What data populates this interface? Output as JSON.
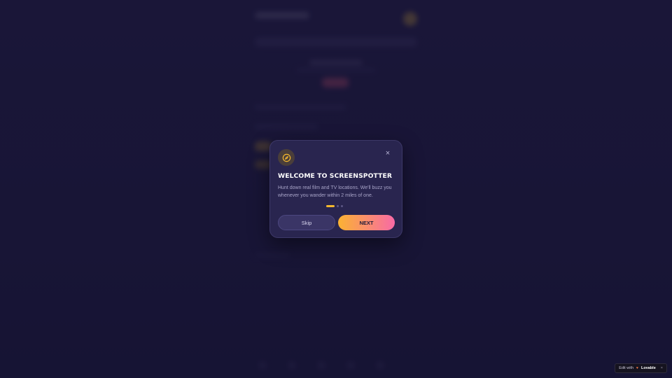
{
  "modal": {
    "title": "Welcome to ScreenSpotter",
    "body": "Hunt down real film and TV locations. We'll buzz you whenever you wander within 2 miles of one.",
    "close_symbol": "×",
    "icon": "compass-icon",
    "step": {
      "current": 1,
      "total": 3
    },
    "skip_label": "Skip",
    "next_label": "NEXT"
  },
  "badge": {
    "prefix": "Edit with",
    "brand": "Lovable",
    "close_symbol": "×"
  },
  "colors": {
    "background": "#1f1b44",
    "modal": "#29254f",
    "accent_yellow": "#f5b82e",
    "accent_pink": "#f86aa6"
  }
}
